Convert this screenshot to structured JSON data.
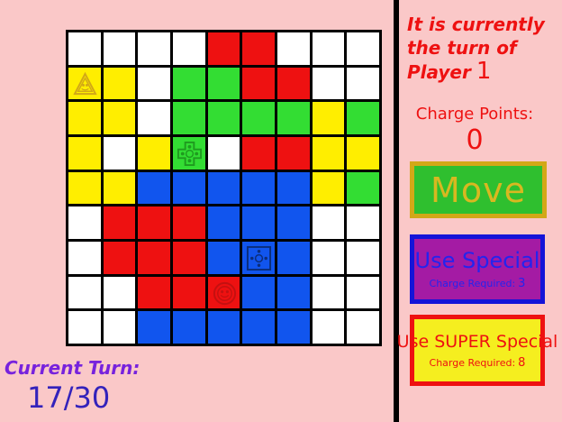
{
  "status": {
    "turn_text": "It is currently the turn of Player",
    "player_number": "1",
    "charge_points_label": "Charge Points:",
    "charge_points_value": "0"
  },
  "buttons": {
    "move_label": "Move",
    "special_label": "Use Special",
    "special_charge_label": "Charge Required:",
    "special_charge_value": "3",
    "super_label": "Use SUPER Special",
    "super_charge_label": "Charge Required:",
    "super_charge_value": "8"
  },
  "turn_counter": {
    "label": "Current Turn:",
    "value": "17/30"
  },
  "colors": {
    "W": "#ffffff",
    "R": "#ee1111",
    "G": "#33dd33",
    "Y": "#ffee00",
    "B": "#1155ee"
  },
  "board": [
    [
      "W",
      "W",
      "W",
      "W",
      "R",
      "R",
      "W",
      "W",
      "W"
    ],
    [
      "Y",
      "Y",
      "W",
      "G",
      "G",
      "R",
      "R",
      "W",
      "W"
    ],
    [
      "Y",
      "Y",
      "W",
      "G",
      "G",
      "G",
      "G",
      "Y",
      "G"
    ],
    [
      "Y",
      "W",
      "Y",
      "G",
      "W",
      "R",
      "R",
      "Y",
      "Y"
    ],
    [
      "Y",
      "Y",
      "B",
      "B",
      "B",
      "B",
      "B",
      "Y",
      "G"
    ],
    [
      "W",
      "R",
      "R",
      "R",
      "B",
      "B",
      "B",
      "W",
      "W"
    ],
    [
      "W",
      "R",
      "R",
      "R",
      "B",
      "B",
      "B",
      "W",
      "W"
    ],
    [
      "W",
      "W",
      "R",
      "R",
      "R",
      "B",
      "B",
      "W",
      "W"
    ],
    [
      "W",
      "W",
      "B",
      "B",
      "B",
      "B",
      "B",
      "W",
      "W"
    ]
  ],
  "pieces": [
    {
      "row": 1,
      "col": 0,
      "icon": "triangle-face-icon",
      "color": "#d2a817"
    },
    {
      "row": 3,
      "col": 3,
      "icon": "cross-face-icon",
      "color": "#1f9a1f"
    },
    {
      "row": 6,
      "col": 5,
      "icon": "square-dots-icon",
      "color": "#0b2d7a"
    },
    {
      "row": 7,
      "col": 4,
      "icon": "circle-face-icon",
      "color": "#c41010"
    }
  ]
}
